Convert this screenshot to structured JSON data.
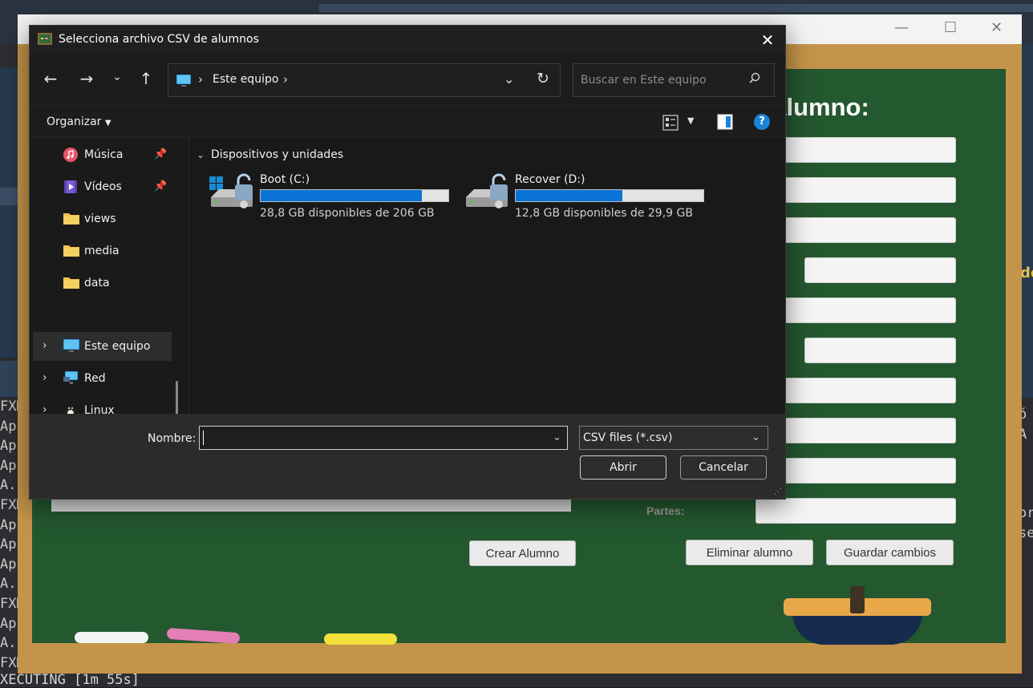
{
  "dialog": {
    "title": "Selecciona archivo CSV de alumnos",
    "address": "Este equipo",
    "search_placeholder": "Buscar en Este equipo",
    "organize": "Organizar",
    "sidebar": [
      {
        "label": "Música",
        "icon": "music-icon",
        "pinned": true
      },
      {
        "label": "Vídeos",
        "icon": "video-icon",
        "pinned": true
      },
      {
        "label": "views",
        "icon": "folder-icon",
        "pinned": false
      },
      {
        "label": "media",
        "icon": "folder-icon",
        "pinned": false
      },
      {
        "label": "data",
        "icon": "folder-icon",
        "pinned": false
      },
      {
        "label": "Este equipo",
        "icon": "computer-icon",
        "selected": true
      },
      {
        "label": "Red",
        "icon": "network-icon"
      },
      {
        "label": "Linux",
        "icon": "linux-icon"
      }
    ],
    "group_header": "Dispositivos y unidades",
    "drives": [
      {
        "name": "Boot (C:)",
        "free": "28,8 GB disponibles de 206 GB",
        "used_fraction": 0.86
      },
      {
        "name": "Recover (D:)",
        "free": "12,8 GB disponibles de 29,9 GB",
        "used_fraction": 0.57
      }
    ],
    "filename_label": "Nombre:",
    "filename_value": "",
    "filter": "CSV files (*.csv)",
    "open_button": "Abrir",
    "cancel_button": "Cancelar"
  },
  "app": {
    "board_title": "l alumno:",
    "partes_label": "Partes:",
    "crear_button": "Crear Alumno",
    "eliminar_button": "Eliminar alumno",
    "guardar_button": "Guardar cambios"
  },
  "ide": {
    "terminal_lines": [
      "FXM",
      "App",
      "App",
      "App",
      "A.",
      "FXM",
      "App",
      "App",
      "App",
      "A.",
      "FXM",
      "App",
      "A.",
      "FXM"
    ],
    "terminal_right": [
      "ó",
      "A",
      "",
      "",
      "",
      "or",
      "se"
    ],
    "right_text": "de",
    "exec_line": "XECUTING [1m 55s]"
  },
  "colors": {
    "accent": "#0a74d6",
    "board_green": "#24582f",
    "wood": "#c4944a"
  }
}
